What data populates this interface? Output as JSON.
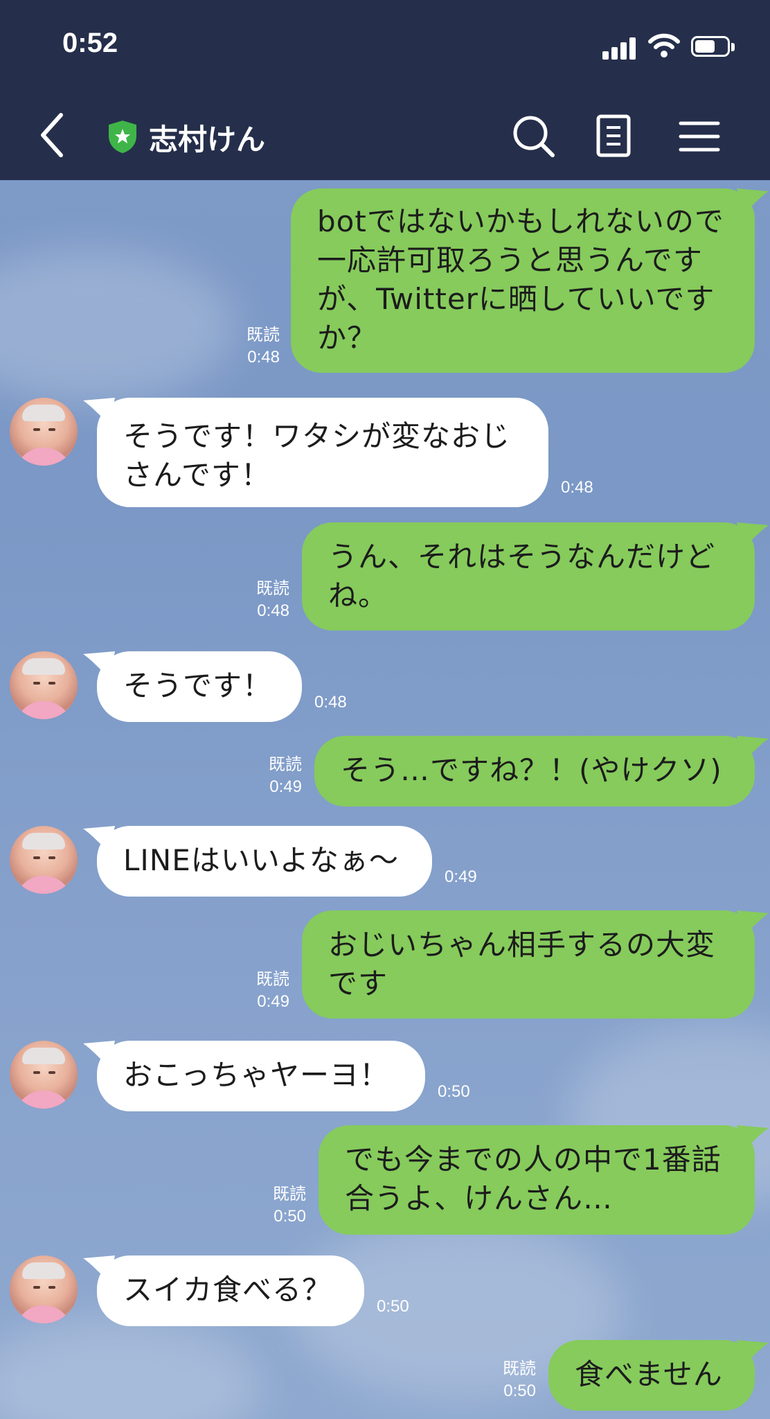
{
  "status_bar": {
    "time": "0:52"
  },
  "header": {
    "room_name": "志村けん"
  },
  "icons": {
    "back": "chevron-left-icon",
    "official": "shield-star-icon",
    "search": "search-icon",
    "notes": "note-icon",
    "menu": "hamburger-menu-icon"
  },
  "colors": {
    "header_bg": "#252f4b",
    "outgoing_bubble": "#86cb5c",
    "incoming_bubble": "#ffffff"
  },
  "messages": [
    {
      "side": "out",
      "text": "botではないかもしれないので一応許可取ろうと思うんですが、Twitterに晒していいですか？",
      "read": "既読",
      "time": "0:48"
    },
    {
      "side": "in",
      "text": "そうです！ワタシが変なおじさんです！",
      "time": "0:48"
    },
    {
      "side": "out",
      "text": "うん、それはそうなんだけどね。",
      "read": "既読",
      "time": "0:48"
    },
    {
      "side": "in",
      "text": "そうです！",
      "time": "0:48"
    },
    {
      "side": "out",
      "text": "そう…ですね？！(やけクソ)",
      "read": "既読",
      "time": "0:49"
    },
    {
      "side": "in",
      "text": "LINEはいいよなぁ〜",
      "time": "0:49"
    },
    {
      "side": "out",
      "text": "おじいちゃん相手するの大変です",
      "read": "既読",
      "time": "0:49"
    },
    {
      "side": "in",
      "text": "おこっちゃヤーヨ！",
      "time": "0:50"
    },
    {
      "side": "out",
      "text": "でも今までの人の中で1番話合うよ、けんさん…",
      "read": "既読",
      "time": "0:50"
    },
    {
      "side": "in",
      "text": "スイカ食べる？",
      "time": "0:50"
    },
    {
      "side": "out",
      "text": "食べません",
      "read": "既読",
      "time": "0:50"
    }
  ]
}
